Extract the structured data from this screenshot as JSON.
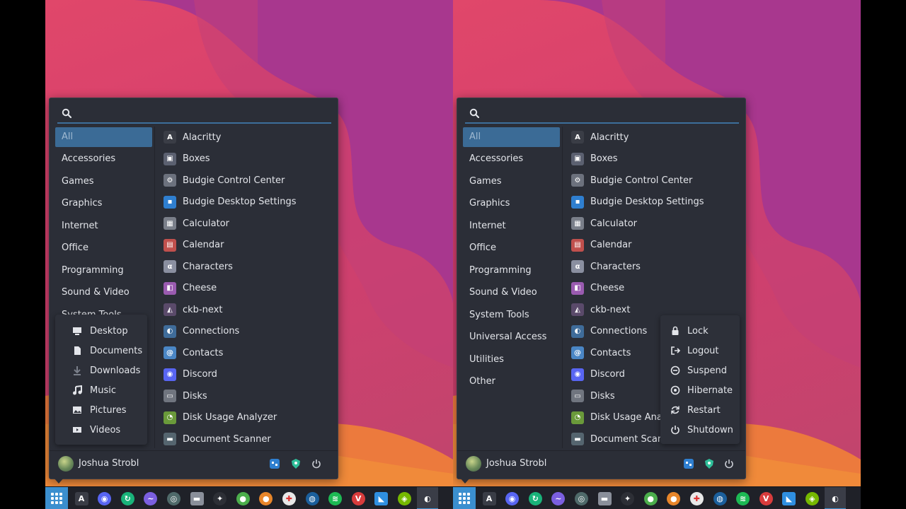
{
  "left_screen": {
    "search": {
      "placeholder": ""
    },
    "categories": [
      "All",
      "Accessories",
      "Games",
      "Graphics",
      "Internet",
      "Office",
      "Programming",
      "Sound & Video",
      "System Tools"
    ],
    "places": [
      {
        "label": "Desktop",
        "icon": "desktop-icon"
      },
      {
        "label": "Documents",
        "icon": "documents-icon"
      },
      {
        "label": "Downloads",
        "icon": "downloads-icon"
      },
      {
        "label": "Music",
        "icon": "music-icon"
      },
      {
        "label": "Pictures",
        "icon": "pictures-icon"
      },
      {
        "label": "Videos",
        "icon": "videos-icon"
      }
    ],
    "apps": [
      "Alacritty",
      "Boxes",
      "Budgie Control Center",
      "Budgie Desktop Settings",
      "Calculator",
      "Calendar",
      "Characters",
      "Cheese",
      "ckb-next",
      "Connections",
      "Contacts",
      "Discord",
      "Disks",
      "Disk Usage Analyzer",
      "Document Scanner"
    ],
    "user": "Joshua Strobl"
  },
  "right_screen": {
    "search": {
      "placeholder": ""
    },
    "categories": [
      "All",
      "Accessories",
      "Games",
      "Graphics",
      "Internet",
      "Office",
      "Programming",
      "Sound & Video",
      "System Tools",
      "Universal Access",
      "Utilities",
      "Other"
    ],
    "apps": [
      "Alacritty",
      "Boxes",
      "Budgie Control Center",
      "Budgie Desktop Settings",
      "Calculator",
      "Calendar",
      "Characters",
      "Cheese",
      "ckb-next",
      "Connections",
      "Contacts",
      "Discord",
      "Disks",
      "Disk Usage Analyzer",
      "Document Scanner"
    ],
    "power_menu": [
      {
        "label": "Lock",
        "icon": "lock-icon"
      },
      {
        "label": "Logout",
        "icon": "logout-icon"
      },
      {
        "label": "Suspend",
        "icon": "suspend-icon"
      },
      {
        "label": "Hibernate",
        "icon": "hibernate-icon"
      },
      {
        "label": "Restart",
        "icon": "restart-icon"
      },
      {
        "label": "Shutdown",
        "icon": "shutdown-icon"
      }
    ],
    "user": "Joshua Strobl"
  },
  "app_icons": {
    "Alacritty": {
      "icon": "alacritty-icon",
      "color": "#3a3d46",
      "glyph": "A"
    },
    "Boxes": {
      "icon": "boxes-icon",
      "color": "#5b6070",
      "glyph": "▣"
    },
    "Budgie Control Center": {
      "icon": "gear-icon",
      "color": "#6c717d",
      "glyph": "⚙"
    },
    "Budgie Desktop Settings": {
      "icon": "budgie-settings-icon",
      "color": "#2f7fd0",
      "glyph": "▪"
    },
    "Calculator": {
      "icon": "calculator-icon",
      "color": "#7a7f8a",
      "glyph": "▦"
    },
    "Calendar": {
      "icon": "calendar-icon",
      "color": "#c0504d",
      "glyph": "▤"
    },
    "Characters": {
      "icon": "characters-icon",
      "color": "#8a8fa0",
      "glyph": "α"
    },
    "Cheese": {
      "icon": "cheese-icon",
      "color": "#9a5bb0",
      "glyph": "◧"
    },
    "ckb-next": {
      "icon": "ckb-next-icon",
      "color": "#5a4a6a",
      "glyph": "◭"
    },
    "Connections": {
      "icon": "connections-icon",
      "color": "#3f6c9a",
      "glyph": "◐"
    },
    "Contacts": {
      "icon": "contacts-icon",
      "color": "#4a86c5",
      "glyph": "@"
    },
    "Discord": {
      "icon": "discord-icon",
      "color": "#5865f2",
      "glyph": "◉"
    },
    "Disks": {
      "icon": "disks-icon",
      "color": "#70757f",
      "glyph": "▭"
    },
    "Disk Usage Analyzer": {
      "icon": "disk-usage-analyzer-icon",
      "color": "#6a9a3a",
      "glyph": "◔"
    },
    "Document Scanner": {
      "icon": "document-scanner-icon",
      "color": "#55656f",
      "glyph": "▬"
    }
  },
  "taskbar": [
    {
      "icon": "app-menu-icon"
    },
    {
      "icon": "alacritty-icon",
      "color": "#3a3d46",
      "glyph": "A"
    },
    {
      "icon": "discord-icon",
      "color": "#5865f2",
      "glyph": "◉"
    },
    {
      "icon": "sync-icon",
      "color": "#19b37a",
      "glyph": "↻"
    },
    {
      "icon": "waves-icon",
      "color": "#7b5fe0",
      "glyph": "~"
    },
    {
      "icon": "orb-icon",
      "color": "#4f6a6a",
      "glyph": "◎"
    },
    {
      "icon": "files-icon",
      "color": "#8a8f9a",
      "glyph": "▬"
    },
    {
      "icon": "lutris-icon",
      "color": "#2d2f36",
      "glyph": "✦"
    },
    {
      "icon": "lightbulb-icon",
      "color": "#4cae4c",
      "glyph": "●"
    },
    {
      "icon": "firefox-icon",
      "color": "#e8862a",
      "glyph": "●"
    },
    {
      "icon": "slack-icon",
      "color": "#e8e8e8",
      "glyph": "✚"
    },
    {
      "icon": "steam-icon",
      "color": "#1b5f9c",
      "glyph": "◍"
    },
    {
      "icon": "spotify-icon",
      "color": "#1db954",
      "glyph": "≋"
    },
    {
      "icon": "vivaldi-icon",
      "color": "#d83c3c",
      "glyph": "V"
    },
    {
      "icon": "vscode-icon",
      "color": "#2f8fe0",
      "glyph": "◣"
    },
    {
      "icon": "nvidia-icon",
      "color": "#76b900",
      "glyph": "◈"
    },
    {
      "icon": "obs-icon",
      "color": "#3a3d47",
      "glyph": "◐"
    }
  ]
}
